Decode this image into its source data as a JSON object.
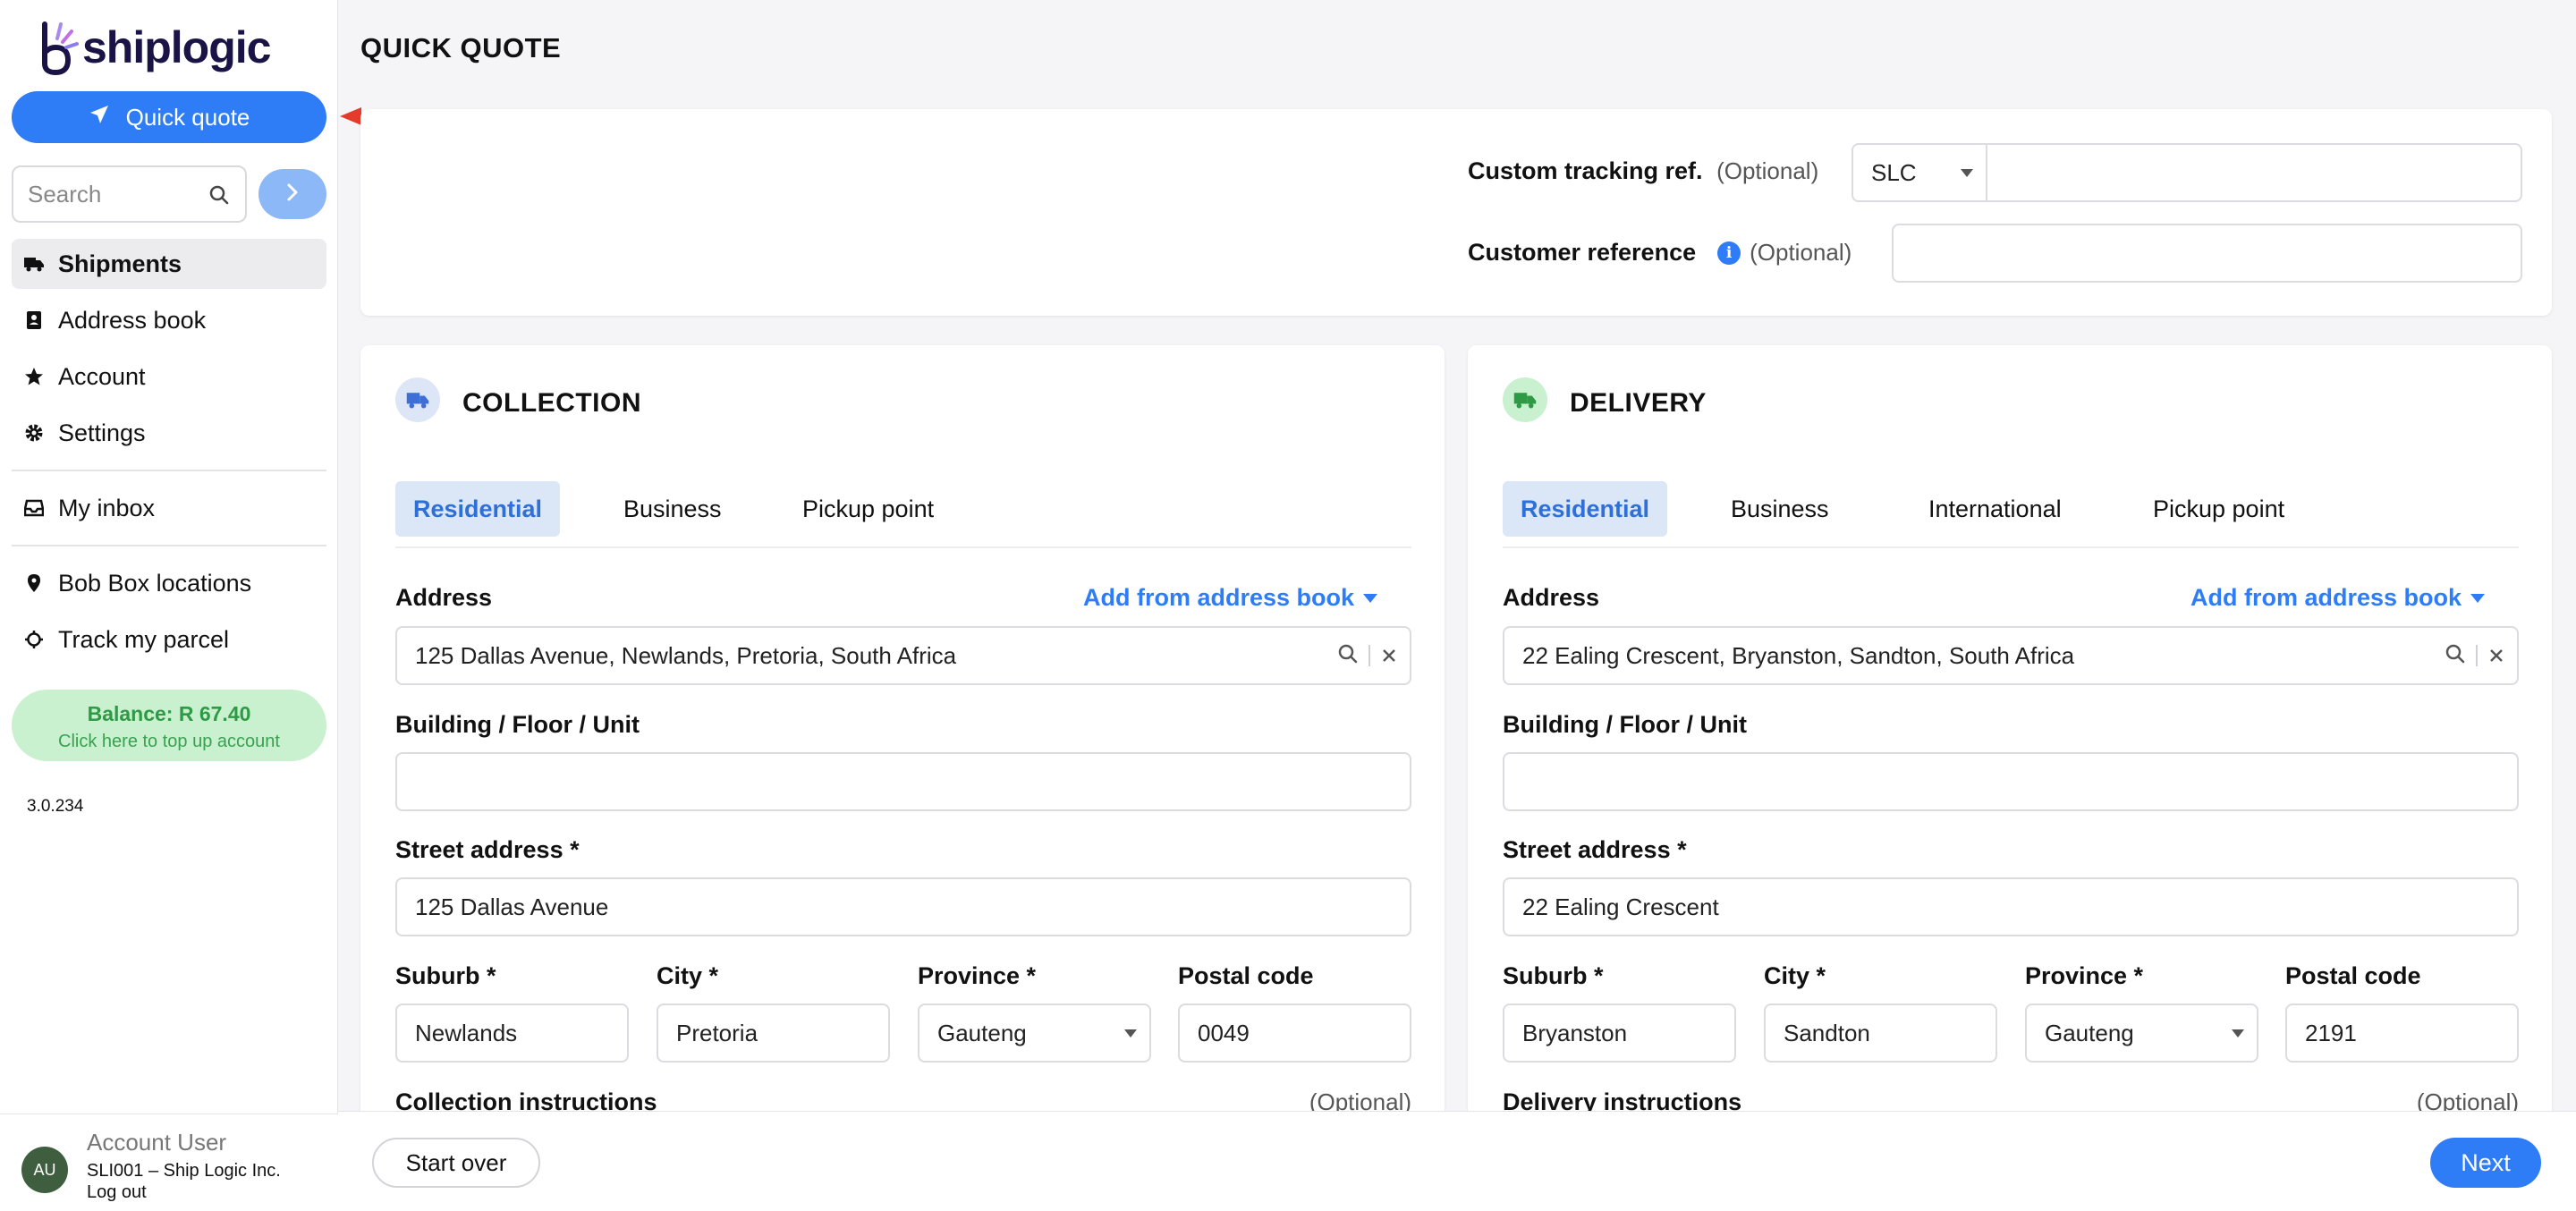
{
  "app": {
    "logo_text": "shiplogic"
  },
  "sidebar": {
    "quick_quote_label": "Quick quote",
    "search_placeholder": "Search",
    "nav": {
      "shipments": "Shipments",
      "address_book": "Address book",
      "account": "Account",
      "settings": "Settings",
      "my_inbox": "My inbox",
      "bob_box_locations": "Bob Box locations",
      "track_my_parcel": "Track my parcel"
    },
    "balance": {
      "label": "Balance: R 67.40",
      "hint": "Click here to top up account"
    },
    "version": "3.0.234",
    "user": {
      "initials": "AU",
      "name": "Account User",
      "org": "SLI001 – Ship Logic Inc.",
      "logout": "Log out"
    }
  },
  "page": {
    "title": "QUICK QUOTE"
  },
  "tracking": {
    "custom_ref_label": "Custom tracking ref.",
    "custom_ref_optional": "(Optional)",
    "prefix_value": "SLC",
    "custom_ref_value": "",
    "customer_ref_label": "Customer reference",
    "customer_ref_optional": "(Optional)",
    "customer_ref_value": ""
  },
  "collection": {
    "title": "COLLECTION",
    "tabs": {
      "residential": "Residential",
      "business": "Business",
      "pickup_point": "Pickup point"
    },
    "address_label": "Address",
    "add_from_book": "Add from address book",
    "address_value": "125 Dallas Avenue, Newlands, Pretoria, South Africa",
    "building_label": "Building / Floor / Unit",
    "building_value": "",
    "street_label": "Street address *",
    "street_value": "125 Dallas Avenue",
    "suburb_label": "Suburb *",
    "suburb_value": "Newlands",
    "city_label": "City *",
    "city_value": "Pretoria",
    "province_label": "Province *",
    "province_value": "Gauteng",
    "postal_label": "Postal code",
    "postal_value": "0049",
    "instructions_label": "Collection instructions",
    "instructions_optional": "(Optional)"
  },
  "delivery": {
    "title": "DELIVERY",
    "tabs": {
      "residential": "Residential",
      "business": "Business",
      "international": "International",
      "pickup_point": "Pickup point"
    },
    "address_label": "Address",
    "add_from_book": "Add from address book",
    "address_value": "22 Ealing Crescent, Bryanston, Sandton, South Africa",
    "building_label": "Building / Floor / Unit",
    "building_value": "",
    "street_label": "Street address *",
    "street_value": "22 Ealing Crescent",
    "suburb_label": "Suburb *",
    "suburb_value": "Bryanston",
    "city_label": "City *",
    "city_value": "Sandton",
    "province_label": "Province *",
    "province_value": "Gauteng",
    "postal_label": "Postal code",
    "postal_value": "2191",
    "instructions_label": "Delivery instructions",
    "instructions_optional": "(Optional)"
  },
  "footer": {
    "start_over": "Start over",
    "next": "Next"
  },
  "colors": {
    "primary": "#2e7cf6",
    "balance_bg": "#c9f0cf",
    "balance_text": "#2f9a45",
    "annotation_arrow": "#e53b2c"
  }
}
